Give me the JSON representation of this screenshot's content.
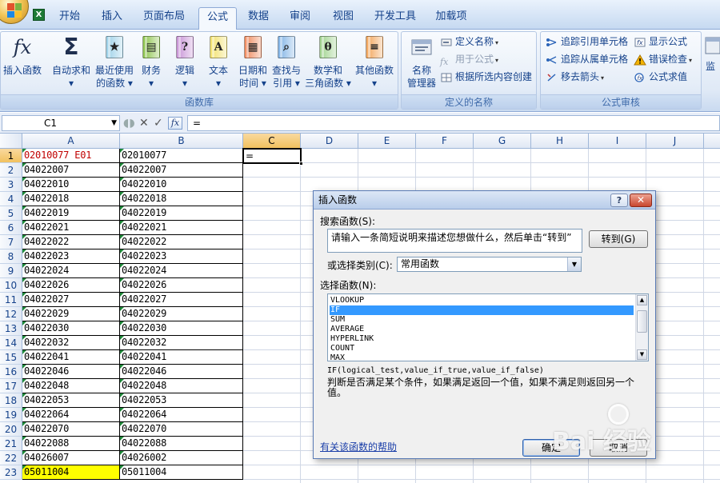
{
  "ribbon": {
    "tabs": [
      "开始",
      "插入",
      "页面布局",
      "公式",
      "数据",
      "审阅",
      "视图",
      "开发工具",
      "加载项"
    ],
    "active_tab": "公式",
    "groups": {
      "function_library": {
        "label": "函数库",
        "buttons": [
          {
            "line1": "插入函数",
            "line2": ""
          },
          {
            "line1": "自动求和",
            "line2": "▾"
          },
          {
            "line1": "最近使用",
            "line2": "的函数 ▾"
          },
          {
            "line1": "财务",
            "line2": "▾"
          },
          {
            "line1": "逻辑",
            "line2": "▾"
          },
          {
            "line1": "文本",
            "line2": "▾"
          },
          {
            "line1": "日期和",
            "line2": "时间 ▾"
          },
          {
            "line1": "查找与",
            "line2": "引用 ▾"
          },
          {
            "line1": "数学和",
            "line2": "三角函数 ▾"
          },
          {
            "line1": "其他函数",
            "line2": "▾"
          }
        ]
      },
      "defined_names": {
        "label": "定义的名称",
        "big_line1": "名称",
        "big_line2": "管理器",
        "define_name": "定义名称",
        "use_in_formula": "用于公式",
        "create_from_selection": "根据所选内容创建"
      },
      "formula_auditing": {
        "label": "公式审核",
        "trace_precedents": "追踪引用单元格",
        "trace_dependents": "追踪从属单元格",
        "remove_arrows": "移去箭头",
        "show_formulas": "显示公式",
        "error_checking": "错误检查",
        "evaluate_formula": "公式求值",
        "watch_window": "监"
      }
    }
  },
  "formula_bar": {
    "name_box": "C1",
    "content": "="
  },
  "grid": {
    "columns": [
      "A",
      "B",
      "C",
      "D",
      "E",
      "F",
      "G",
      "H",
      "I",
      "J"
    ],
    "selected_column": "C",
    "row_numbers": [
      "1",
      "2",
      "3",
      "4",
      "5",
      "6",
      "7",
      "8",
      "9",
      "10",
      "11",
      "12",
      "13",
      "14",
      "15",
      "16",
      "17",
      "18",
      "19",
      "20",
      "21",
      "22",
      "23"
    ],
    "col_a": [
      "02010077 E01",
      "04022007",
      "04022010",
      "04022018",
      "04022019",
      "04022021",
      "04022022",
      "04022023",
      "04022024",
      "04022026",
      "04022027",
      "04022029",
      "04022030",
      "04022032",
      "04022041",
      "04022046",
      "04022048",
      "04022053",
      "04022064",
      "04022070",
      "04022088",
      "04026007",
      "05011004"
    ],
    "col_b": [
      "02010077",
      "04022007",
      "04022010",
      "04022018",
      "04022019",
      "04022021",
      "04022022",
      "04022023",
      "04022024",
      "04022026",
      "04022027",
      "04022029",
      "04022030",
      "04022032",
      "04022041",
      "04022046",
      "04022048",
      "04022053",
      "04022064",
      "04022070",
      "04022088",
      "04026002",
      "05011004"
    ],
    "active_cell_value": "=",
    "colors": {
      "a1_text": "#c00000",
      "a23_fill": "#ffff00",
      "selected_header": "#f4c668"
    }
  },
  "dialog": {
    "title": "插入函数",
    "search_label": "搜索函数(S):",
    "search_value": "请输入一条简短说明来描述您想做什么，然后单击“转到”",
    "go_button": "转到(G)",
    "category_label": "或选择类别(C):",
    "category_value": "常用函数",
    "function_label": "选择函数(N):",
    "functions": [
      "VLOOKUP",
      "IF",
      "SUM",
      "AVERAGE",
      "HYPERLINK",
      "COUNT",
      "MAX"
    ],
    "selected_function": "IF",
    "syntax": "IF(logical_test,value_if_true,value_if_false)",
    "description": "判断是否满足某个条件，如果满足返回一个值，如果不满足则返回另一个值。",
    "help_link": "有关该函数的帮助",
    "ok_button": "确定",
    "cancel_button": "取消"
  },
  "watermark": {
    "text": "Bai  经验"
  }
}
